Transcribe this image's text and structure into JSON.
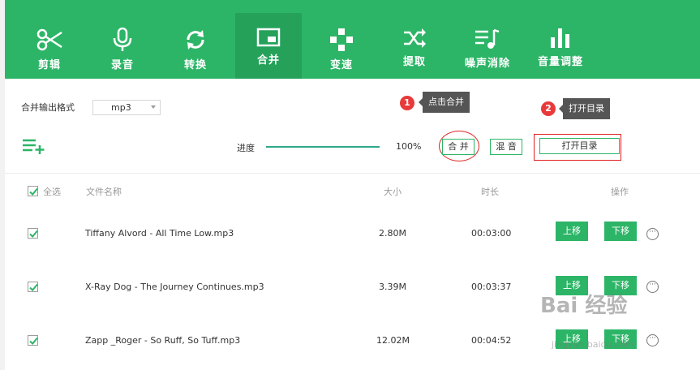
{
  "toolbar": {
    "items": [
      {
        "label": "剪辑",
        "icon": "scissors-icon"
      },
      {
        "label": "录音",
        "icon": "microphone-icon"
      },
      {
        "label": "转换",
        "icon": "convert-icon"
      },
      {
        "label": "合并",
        "icon": "merge-icon",
        "active": true
      },
      {
        "label": "变速",
        "icon": "speed-icon"
      },
      {
        "label": "提取",
        "icon": "extract-icon"
      },
      {
        "label": "噪声消除",
        "icon": "noise-icon"
      },
      {
        "label": "音量调整",
        "icon": "volume-icon"
      }
    ],
    "accent": "#2db567"
  },
  "settings": {
    "format_label": "合并输出格式",
    "format_value": "mp3"
  },
  "progress": {
    "label": "进度",
    "value_text": "100%",
    "fraction": 1.0
  },
  "actions": {
    "merge": "合 并",
    "mix": "混 音",
    "open_dir": "打开目录"
  },
  "annotations": {
    "step1_num": "1",
    "step1_text": "点击合并",
    "step2_num": "2",
    "step2_text": "打开目录"
  },
  "table": {
    "headers": {
      "select_all": "全选",
      "name": "文件名称",
      "size": "大小",
      "duration": "时长",
      "ops": "操作"
    },
    "rows": [
      {
        "name": "Tiffany Alvord - All Time Low.mp3",
        "size": "2.80M",
        "duration": "00:03:00",
        "up": "上移",
        "down": "下移"
      },
      {
        "name": "X-Ray Dog - The Journey Continues.mp3",
        "size": "3.39M",
        "duration": "00:03:37",
        "up": "上移",
        "down": "下移"
      },
      {
        "name": "Zapp _Roger - So Ruff, So Tuff.mp3",
        "size": "12.02M",
        "duration": "00:04:52",
        "up": "上移",
        "down": "下移"
      }
    ]
  },
  "watermark": {
    "main": "Bai 经验",
    "sub": "jingyan.baidu.com"
  }
}
